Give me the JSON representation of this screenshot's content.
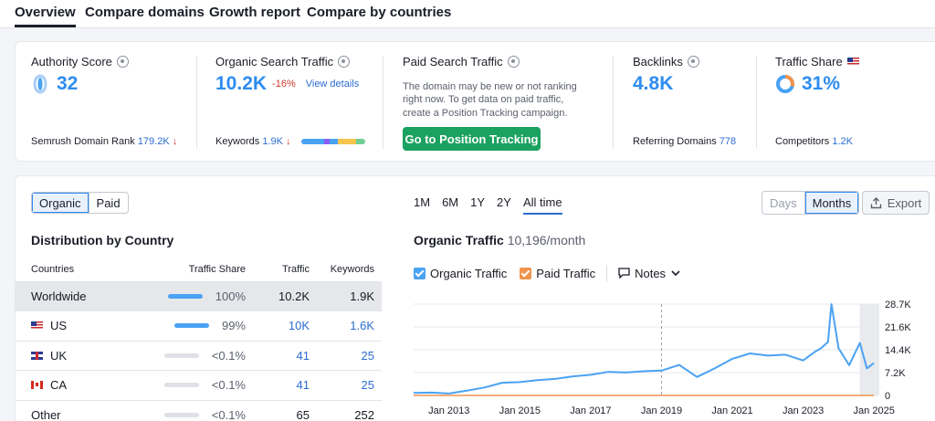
{
  "tabs": [
    "Overview",
    "Compare domains",
    "Growth report",
    "Compare by countries"
  ],
  "summary": {
    "authority": {
      "title": "Authority Score",
      "value": "32",
      "rank_label": "Semrush Domain Rank",
      "rank_value": "179.2K",
      "rank_arrow": "↓"
    },
    "organic": {
      "title": "Organic Search Traffic",
      "value": "10.2K",
      "change": "-16%",
      "link": "View details",
      "kw_label": "Keywords",
      "kw_value": "1.9K",
      "kw_arrow": "↓"
    },
    "paid": {
      "title": "Paid Search Traffic",
      "desc": "The domain may be new or not ranking right now. To get data on paid traffic, create a Position Tracking campaign.",
      "button": "Go to Position Tracking"
    },
    "backlinks": {
      "title": "Backlinks",
      "value": "4.8K",
      "ref_label": "Referring Domains",
      "ref_value": "778"
    },
    "share": {
      "title": "Traffic Share",
      "value": "31%",
      "comp_label": "Competitors",
      "comp_value": "1.2K"
    }
  },
  "toggle": {
    "organic": "Organic",
    "paid": "Paid"
  },
  "distribution": {
    "title": "Distribution by Country",
    "headers": [
      "Countries",
      "Traffic Share",
      "Traffic",
      "Keywords"
    ],
    "rows": [
      {
        "country": "Worldwide",
        "share": "100%",
        "traffic": "10.2K",
        "keywords": "1.9K"
      },
      {
        "country": "US",
        "share": "99%",
        "traffic": "10K",
        "keywords": "1.6K"
      },
      {
        "country": "UK",
        "share": "<0.1%",
        "traffic": "41",
        "keywords": "25"
      },
      {
        "country": "CA",
        "share": "<0.1%",
        "traffic": "41",
        "keywords": "25"
      },
      {
        "country": "Other",
        "share": "<0.1%",
        "traffic": "65",
        "keywords": "252"
      }
    ]
  },
  "ranges": [
    "1M",
    "6M",
    "1Y",
    "2Y",
    "All time"
  ],
  "period": {
    "days": "Days",
    "months": "Months"
  },
  "export_label": "Export",
  "traffic": {
    "title": "Organic Traffic",
    "value": "10,196/month",
    "legend_organic": "Organic Traffic",
    "legend_paid": "Paid Traffic",
    "notes": "Notes"
  },
  "colors": {
    "organic": "#4aa2f3",
    "paid": "#f0944d",
    "accent": "#2d8cf0",
    "button": "#1ba160"
  },
  "chart_data": {
    "type": "line",
    "x_ticks": [
      "Jan 2013",
      "Jan 2015",
      "Jan 2017",
      "Jan 2019",
      "Jan 2021",
      "Jan 2023",
      "Jan 2025"
    ],
    "y_ticks": [
      "28.7K",
      "21.6K",
      "14.4K",
      "7.2K",
      "0"
    ],
    "ylim": [
      0,
      28700
    ],
    "series": [
      {
        "name": "Organic Traffic",
        "x": [
          2012.0,
          2012.5,
          2013.0,
          2013.5,
          2014.0,
          2014.5,
          2015.0,
          2015.5,
          2016.0,
          2016.5,
          2017.0,
          2017.5,
          2018.0,
          2018.5,
          2019.0,
          2019.5,
          2020.0,
          2020.5,
          2021.0,
          2021.5,
          2022.0,
          2022.5,
          2023.0,
          2023.3,
          2023.5,
          2023.7,
          2023.8,
          2024.0,
          2024.3,
          2024.6,
          2024.8,
          2025.0
        ],
        "values": [
          800,
          900,
          600,
          1500,
          2500,
          4000,
          4200,
          4800,
          5200,
          6000,
          6500,
          7400,
          7200,
          7600,
          7800,
          9600,
          5800,
          8500,
          11500,
          13200,
          12500,
          12800,
          11000,
          13500,
          14800,
          16800,
          28700,
          14800,
          9500,
          16500,
          8500,
          10200
        ]
      },
      {
        "name": "Paid Traffic",
        "x": [
          2012.0,
          2025.0
        ],
        "values": [
          0,
          0
        ]
      }
    ]
  }
}
